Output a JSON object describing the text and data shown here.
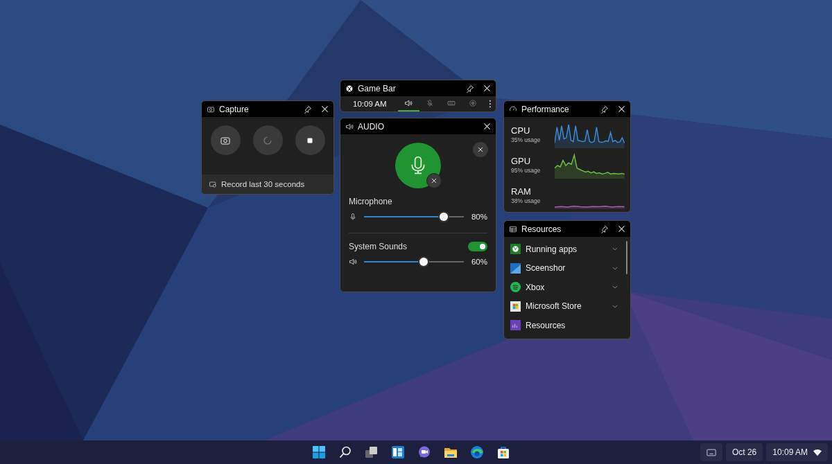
{
  "capture": {
    "title": "Capture",
    "footer": "Record last 30 seconds"
  },
  "game_bar": {
    "title": "Game Bar",
    "time": "10:09 AM",
    "tools": [
      {
        "kind": "audio",
        "selected": true
      },
      {
        "kind": "microphone",
        "selected": false
      },
      {
        "kind": "keyboard",
        "selected": false
      },
      {
        "kind": "settings",
        "selected": false
      }
    ]
  },
  "audio": {
    "title": "AUDIO",
    "microphone": {
      "label": "Microphone",
      "level": 0.8,
      "reading": "80%"
    },
    "system_sounds": {
      "label": "System Sounds",
      "on": true,
      "level": 0.6,
      "reading": "60%"
    }
  },
  "performance": {
    "title": "Performance",
    "metrics": [
      {
        "name": "CPU",
        "usage": "35% usage",
        "color": "#3b8ad9"
      },
      {
        "name": "GPU",
        "usage": "95% usage",
        "color": "#6cc040"
      },
      {
        "name": "RAM",
        "usage": "38% usage",
        "color": "#b05ab8"
      }
    ]
  },
  "resources": {
    "title": "Resources",
    "items": [
      {
        "kind": "xbox",
        "label": "Running apps",
        "expandable": true
      },
      {
        "kind": "screenshot",
        "label": "Sceenshor",
        "expandable": true
      },
      {
        "kind": "music",
        "label": "Xbox",
        "expandable": true
      },
      {
        "kind": "store",
        "label": "Microsoft Store",
        "expandable": true
      },
      {
        "kind": "resources",
        "label": "Resources",
        "expandable": false
      }
    ]
  },
  "taskbar": {
    "apps": [
      {
        "kind": "start"
      },
      {
        "kind": "search"
      },
      {
        "kind": "task-view"
      },
      {
        "kind": "widgets"
      },
      {
        "kind": "chat"
      },
      {
        "kind": "files"
      },
      {
        "kind": "browser"
      },
      {
        "kind": "store"
      }
    ],
    "date": "Oct 26",
    "time": "10:09 AM"
  }
}
